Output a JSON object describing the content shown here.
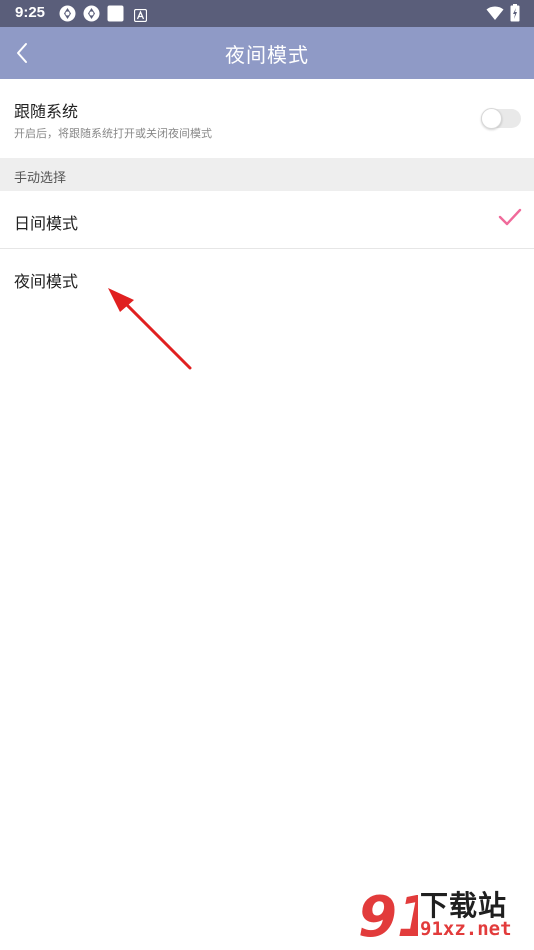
{
  "status_bar": {
    "time": "9:25",
    "notification_icons": [
      "sync-icon",
      "sync-icon",
      "app-square-icon",
      "font-a-icon"
    ],
    "right_icons": [
      "wifi-icon",
      "battery-charging-icon"
    ],
    "background": "#5a5e7a"
  },
  "app_bar": {
    "title": "夜间模式",
    "back_icon": "chevron-left-icon",
    "background": "#8f9ac6"
  },
  "follow_system": {
    "title": "跟随系统",
    "description": "开启后，将跟随系统打开或关闭夜间模式",
    "enabled": false
  },
  "manual_section": {
    "header": "手动选择",
    "options": [
      {
        "label": "日间模式",
        "selected": true
      },
      {
        "label": "夜间模式",
        "selected": false
      }
    ],
    "check_color": "#f06a9a"
  },
  "annotation": {
    "arrow_color": "#e02020"
  },
  "watermark": {
    "logo_text": "91",
    "cn_text": "下载站",
    "url_text": "91xz.net",
    "accent": "#e23b3b"
  }
}
